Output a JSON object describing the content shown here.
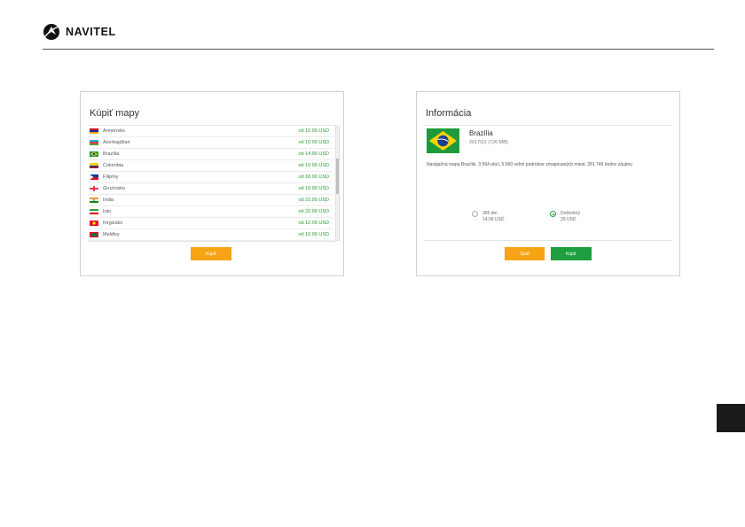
{
  "brand": {
    "name": "NAVITEL",
    "icon": "navitel-logo-icon"
  },
  "buy_panel": {
    "title": "Kúpiť mapy",
    "countries": [
      {
        "name": "Arménsko",
        "price": "od 10.99 USD",
        "flag": "armenia"
      },
      {
        "name": "Azerbajdžan",
        "price": "od 10.99 USD",
        "flag": "azerbaijan"
      },
      {
        "name": "Brazília",
        "price": "od 14.99 USD",
        "flag": "brazil"
      },
      {
        "name": "Colombia",
        "price": "od 10.99 USD",
        "flag": "colombia"
      },
      {
        "name": "Filipíny",
        "price": "od 18.99 USD",
        "flag": "philippines"
      },
      {
        "name": "Gruzínsko",
        "price": "od 10.99 USD",
        "flag": "georgia"
      },
      {
        "name": "India",
        "price": "od 22.99 USD",
        "flag": "india"
      },
      {
        "name": "Irán",
        "price": "od 22.99 USD",
        "flag": "iran"
      },
      {
        "name": "Kirgizsko",
        "price": "od 12.99 USD",
        "flag": "kyrgyzstan"
      },
      {
        "name": "Maldivy",
        "price": "od 10.99 USD",
        "flag": "maldives"
      }
    ],
    "buy_label": "Kúpiť"
  },
  "info_panel": {
    "title": "Informácia",
    "map_name": "Brazília",
    "version": "2017Q1 (726 MB)",
    "description": "Navigačná mapa Brazílie. 3 564 obcí, 5 060 veľmi podrobne zmapovaných miest, 281 746 bodov záujmu",
    "options": [
      {
        "line1": "365 dní",
        "line2": "14.99 USD",
        "selected": false
      },
      {
        "line1": "Doživotný",
        "line2": "29 USD",
        "selected": true
      }
    ],
    "back_label": "Späť",
    "buy_label": "Kúpiť"
  },
  "colors": {
    "accent_orange": "#f7a314",
    "accent_green": "#1e9e3e",
    "price_green": "#2a9a36"
  }
}
